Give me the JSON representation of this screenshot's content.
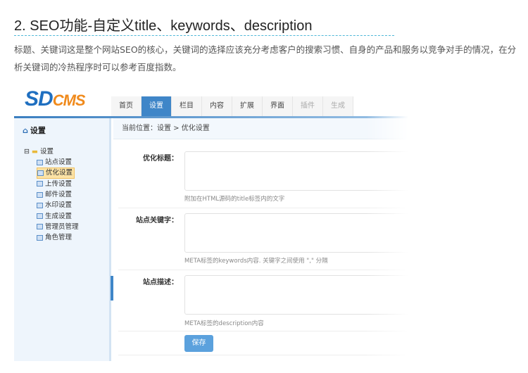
{
  "heading": "2. SEO功能-自定义title、keywords、description",
  "paragraph": "标题、关键词这是整个网站SEO的核心，关键词的选择应该充分考虑客户的搜索习惯、自身的产品和服务以竞争对手的情况，在分析关键词的冷热程序时可以参考百度指数。",
  "app": {
    "logo_main": "SD",
    "logo_sub": "CMS",
    "tabs": [
      {
        "label": "首页"
      },
      {
        "label": "设置"
      },
      {
        "label": "栏目"
      },
      {
        "label": "内容"
      },
      {
        "label": "扩展"
      },
      {
        "label": "界面"
      },
      {
        "label": "插件"
      },
      {
        "label": "生成"
      }
    ],
    "active_tab": "设置",
    "sidebar": {
      "title": "设置",
      "tree_root": "设置",
      "items": [
        {
          "label": "站点设置"
        },
        {
          "label": "优化设置"
        },
        {
          "label": "上传设置"
        },
        {
          "label": "邮件设置"
        },
        {
          "label": "水印设置"
        },
        {
          "label": "生成设置"
        },
        {
          "label": "管理员管理"
        },
        {
          "label": "角色管理"
        }
      ],
      "selected": "优化设置"
    },
    "breadcrumb": "当前位置：设置 > 优化设置",
    "form": {
      "fields": [
        {
          "label": "优化标题：",
          "value": "",
          "hint": "附加在HTML源码的title标签内的文字"
        },
        {
          "label": "站点关键字：",
          "value": "",
          "hint": "META标签的keywords内容. 关键字之间使用 \",\" 分隔"
        },
        {
          "label": "站点描述：",
          "value": "",
          "hint": "META标签的description内容"
        }
      ],
      "save_label": "保存"
    },
    "accent_color": "#3f86c8"
  }
}
